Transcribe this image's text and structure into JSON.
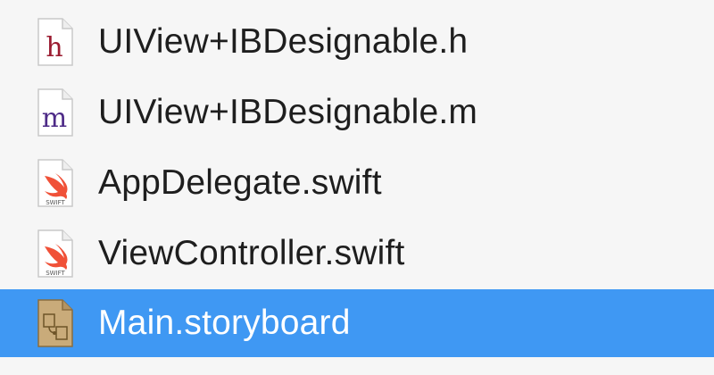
{
  "navigator": {
    "selection_color": "#3f98f3",
    "files": [
      {
        "name": "UIView+IBDesignable.h",
        "icon": "header-file-icon",
        "icon_letter": "h",
        "icon_color": "#9b1b30",
        "selected": false
      },
      {
        "name": "UIView+IBDesignable.m",
        "icon": "objc-implementation-file-icon",
        "icon_letter": "m",
        "icon_color": "#4d2a87",
        "selected": false
      },
      {
        "name": "AppDelegate.swift",
        "icon": "swift-file-icon",
        "icon_badge": "SWIFT",
        "icon_color": "#f05138",
        "selected": false
      },
      {
        "name": "ViewController.swift",
        "icon": "swift-file-icon",
        "icon_badge": "SWIFT",
        "icon_color": "#f05138",
        "selected": false
      },
      {
        "name": "Main.storyboard",
        "icon": "storyboard-file-icon",
        "icon_color": "#a3865a",
        "selected": true
      }
    ]
  }
}
